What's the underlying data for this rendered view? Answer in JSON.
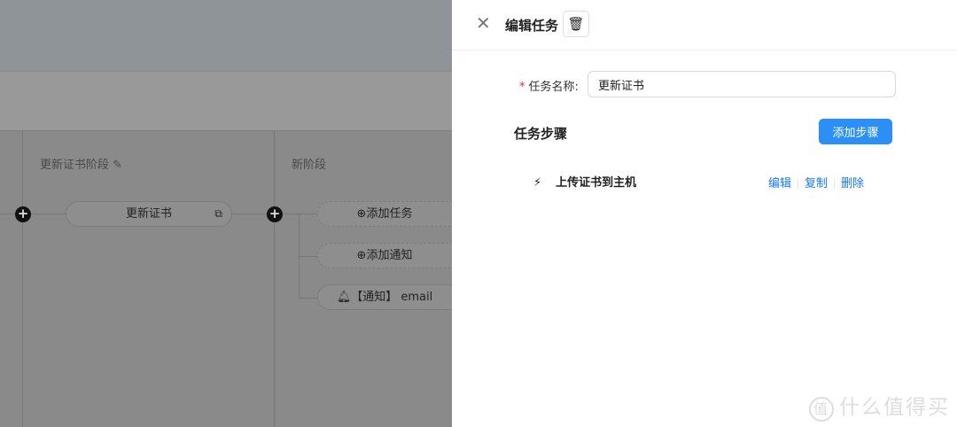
{
  "canvas": {
    "stages": [
      {
        "title": "更新证书阶段",
        "tasks": [
          {
            "label": "更新证书"
          }
        ]
      },
      {
        "title": "新阶段",
        "add_task": "添加任务",
        "add_notice": "添加通知",
        "notice": "【通知】 email"
      }
    ]
  },
  "drawer": {
    "title": "编辑任务",
    "name_label": "任务名称:",
    "name_value": "更新证书",
    "steps_title": "任务步骤",
    "add_step": "添加步骤",
    "steps": [
      {
        "label": "上传证书到主机",
        "edit": "编辑",
        "copy": "复制",
        "delete": "删除"
      }
    ]
  },
  "watermark": {
    "logo": "值",
    "text": "什么值得买"
  },
  "colors": {
    "primary": "#2b8ff5",
    "link": "#1677ff",
    "required": "#f5222d"
  }
}
